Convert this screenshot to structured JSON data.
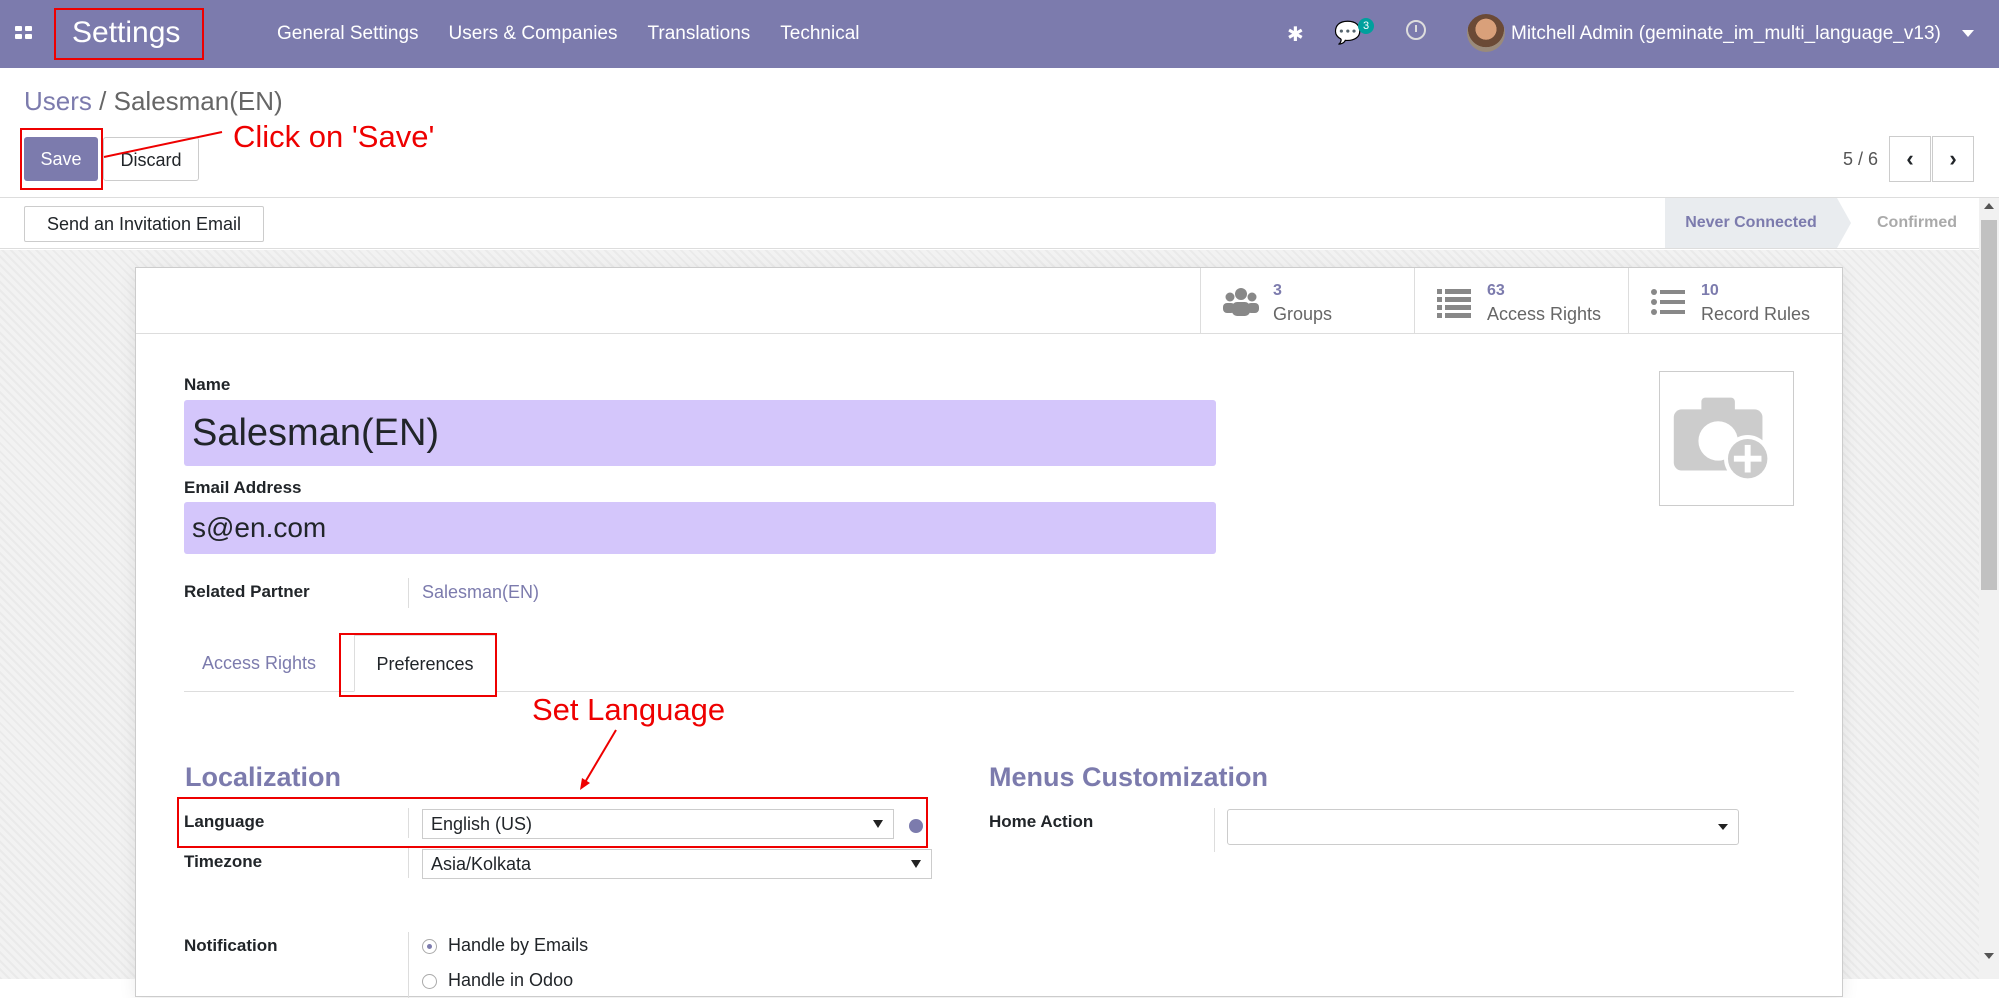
{
  "navbar": {
    "brand": "Settings",
    "menu": [
      "General Settings",
      "Users & Companies",
      "Translations",
      "Technical"
    ],
    "chat_count": "3",
    "user": "Mitchell Admin (geminate_im_multi_language_v13)",
    "icons": [
      "apps-icon",
      "bug-icon",
      "chat-icon",
      "clock-icon",
      "avatar",
      "caret-down-icon"
    ]
  },
  "breadcrumb": {
    "parent": "Users",
    "separator": "/",
    "current": "Salesman(EN)"
  },
  "actions": {
    "save": "Save",
    "discard": "Discard"
  },
  "annotations": {
    "save": "Click on 'Save'",
    "language": "Set Language"
  },
  "pager": {
    "value": "5 / 6",
    "prev_icon": "chevron-left-icon",
    "next_icon": "chevron-right-icon"
  },
  "statusbar": {
    "invite": "Send an Invitation Email",
    "stages": [
      {
        "label": "Never Connected",
        "active": true
      },
      {
        "label": "Confirmed",
        "active": false
      }
    ]
  },
  "stats": [
    {
      "count": "3",
      "label": "Groups",
      "icon": "users-icon"
    },
    {
      "count": "63",
      "label": "Access Rights",
      "icon": "list-icon"
    },
    {
      "count": "10",
      "label": "Record Rules",
      "icon": "list-icon"
    }
  ],
  "form": {
    "name_label": "Name",
    "name": "Salesman(EN)",
    "email_label": "Email Address",
    "email": "s@en.com",
    "partner_label": "Related Partner",
    "partner": "Salesman(EN)",
    "photo_icon": "camera-plus-icon"
  },
  "tabs": [
    {
      "label": "Access Rights",
      "active": false
    },
    {
      "label": "Preferences",
      "active": true
    }
  ],
  "preferences": {
    "localization_title": "Localization",
    "language_label": "Language",
    "language": "English (US)",
    "timezone_label": "Timezone",
    "timezone": "Asia/Kolkata",
    "menus_title": "Menus Customization",
    "home_action_label": "Home Action",
    "home_action": "",
    "notification_label": "Notification",
    "notification_options": [
      "Handle by Emails",
      "Handle in Odoo"
    ],
    "notification_selected": "Handle by Emails"
  },
  "colors": {
    "navbar": "#7c7bad",
    "accent": "#7c7bad",
    "required_field": "#d4c6fb",
    "annotation": "#ee0000",
    "badge": "#00a09d"
  }
}
